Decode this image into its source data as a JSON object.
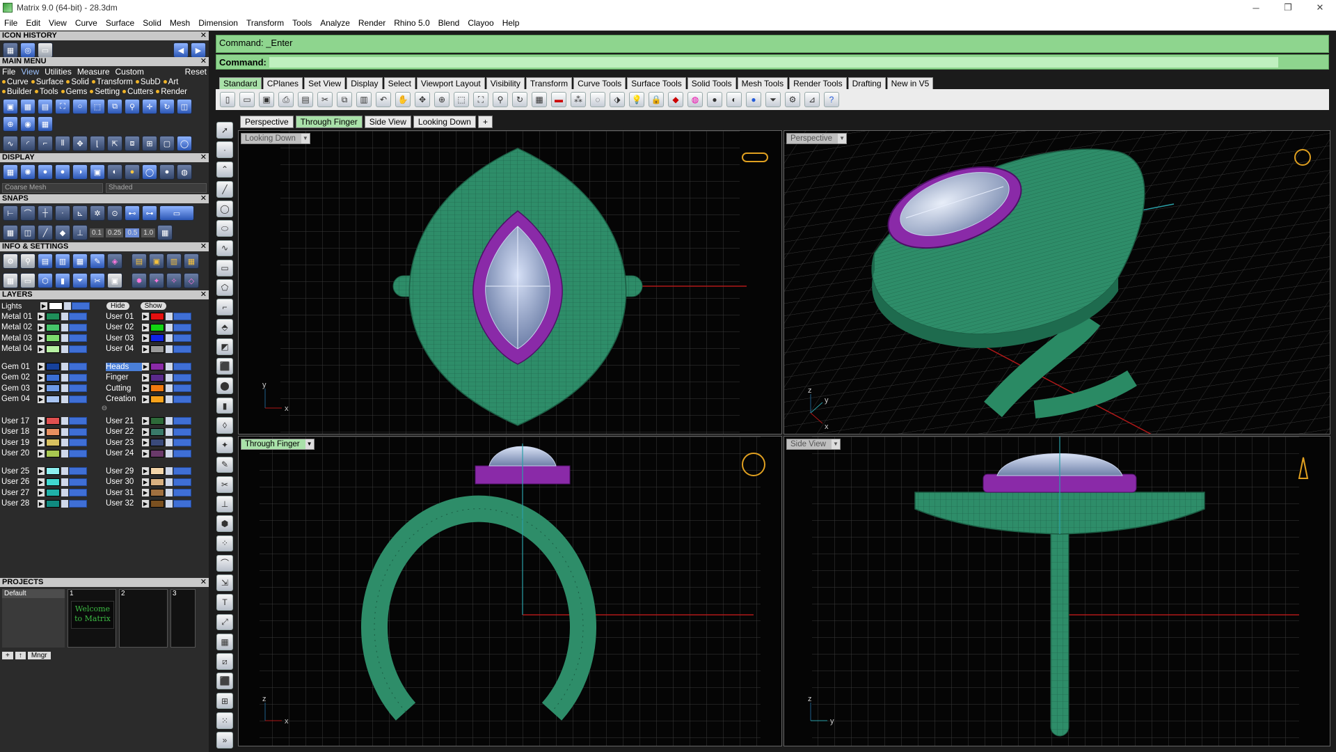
{
  "window": {
    "title": "Matrix 9.0 (64-bit) - 28.3dm",
    "controls": [
      "─",
      "❐",
      "✕"
    ]
  },
  "menubar": [
    "File",
    "Edit",
    "View",
    "Curve",
    "Surface",
    "Solid",
    "Mesh",
    "Dimension",
    "Transform",
    "Tools",
    "Analyze",
    "Render",
    "Rhino 5.0",
    "Blend",
    "Clayoo",
    "Help"
  ],
  "left": {
    "icon_history_title": "ICON HISTORY",
    "main_menu_title": "MAIN MENU",
    "main_menu_row1": [
      "File",
      "View",
      "Utilities",
      "Measure",
      "Custom",
      "Reset"
    ],
    "main_menu_row2": [
      "Curve",
      "Surface",
      "Solid",
      "Transform",
      "SubD",
      "Art"
    ],
    "main_menu_row3": [
      "Builder",
      "Tools",
      "Gems",
      "Setting",
      "Cutters",
      "Render"
    ],
    "display_title": "DISPLAY",
    "display_mesh": "Coarse Mesh",
    "display_mode": "Shaded",
    "snaps_title": "SNAPS",
    "snap_values": [
      "0.1",
      "0.25",
      "0.5",
      "1.0"
    ],
    "info_title": "INFO & SETTINGS",
    "layers_title": "LAYERS",
    "lights_label": "Lights",
    "hide_label": "Hide",
    "show_label": "Show",
    "projects_title": "PROJECTS",
    "project_default": "Default",
    "project_slots": [
      "1",
      "2",
      "3"
    ],
    "welcome_text": "Welcome to Matrix",
    "mngr_label": "Mngr"
  },
  "layers": {
    "group1_left": [
      {
        "name": "Metal 01",
        "color": "#1f8f5a"
      },
      {
        "name": "Metal 02",
        "color": "#46c46a"
      },
      {
        "name": "Metal 03",
        "color": "#7ddc6e"
      },
      {
        "name": "Metal 04",
        "color": "#b7f0a3"
      }
    ],
    "group1_right": [
      {
        "name": "User 01",
        "color": "#e41010"
      },
      {
        "name": "User 02",
        "color": "#12d312"
      },
      {
        "name": "User 03",
        "color": "#1024e6"
      },
      {
        "name": "User 04",
        "color": "#9a9a9a"
      }
    ],
    "group2_left": [
      {
        "name": "Gem 01",
        "color": "#16419c"
      },
      {
        "name": "Gem 02",
        "color": "#3b6fd4"
      },
      {
        "name": "Gem 03",
        "color": "#6e9ae6"
      },
      {
        "name": "Gem 04",
        "color": "#a8c4f2"
      }
    ],
    "group2_right": [
      {
        "name": "Heads",
        "color": "#8a2aa6",
        "selected": true
      },
      {
        "name": "Finger",
        "color": "#5a2a8a"
      },
      {
        "name": "Cutting",
        "color": "#f07a10"
      },
      {
        "name": "Creation",
        "color": "#f6a21c"
      }
    ],
    "group3_left": [
      {
        "name": "User 17",
        "color": "#e05050"
      },
      {
        "name": "User 18",
        "color": "#e89060"
      },
      {
        "name": "User 19",
        "color": "#d8c060"
      },
      {
        "name": "User 20",
        "color": "#a8c850"
      }
    ],
    "group3_right": [
      {
        "name": "User 21",
        "color": "#2e6a3a"
      },
      {
        "name": "User 22",
        "color": "#3a7a6a"
      },
      {
        "name": "User 23",
        "color": "#3a4a7a"
      },
      {
        "name": "User 24",
        "color": "#6a3a6a"
      }
    ],
    "group4_left": [
      {
        "name": "User 25",
        "color": "#8ef0f0"
      },
      {
        "name": "User 26",
        "color": "#40d8d0"
      },
      {
        "name": "User 27",
        "color": "#20b0a8"
      },
      {
        "name": "User 28",
        "color": "#108a80"
      }
    ],
    "group4_right": [
      {
        "name": "User 29",
        "color": "#f2d4a8"
      },
      {
        "name": "User 30",
        "color": "#d8b080"
      },
      {
        "name": "User 31",
        "color": "#a07040"
      },
      {
        "name": "User 32",
        "color": "#7a5020"
      }
    ]
  },
  "command": {
    "history": "Command: _Enter",
    "prompt": "Command:"
  },
  "toolbar_tabs": [
    "Standard",
    "CPlanes",
    "Set View",
    "Display",
    "Select",
    "Viewport Layout",
    "Visibility",
    "Transform",
    "Curve Tools",
    "Surface Tools",
    "Solid Tools",
    "Mesh Tools",
    "Render Tools",
    "Drafting",
    "New in V5"
  ],
  "viewport_tabs": [
    "Perspective",
    "Through Finger",
    "Side View",
    "Looking Down",
    "+"
  ],
  "viewports": {
    "top_left": "Looking Down",
    "top_right": "Perspective",
    "bottom_left": "Through Finger",
    "bottom_right": "Side View"
  },
  "axes": {
    "tl": [
      "y",
      "x"
    ],
    "tr": [
      "z",
      "y",
      "x"
    ],
    "bl": [
      "z",
      "x"
    ],
    "br": [
      "z",
      "y"
    ]
  },
  "colors": {
    "ring_green": "#2d8f6a",
    "bezel_purple": "#8a2aa8",
    "gem_blue": "#9fb3d6",
    "command_green": "#8ed58e",
    "tab_active": "#a9e1a9"
  }
}
